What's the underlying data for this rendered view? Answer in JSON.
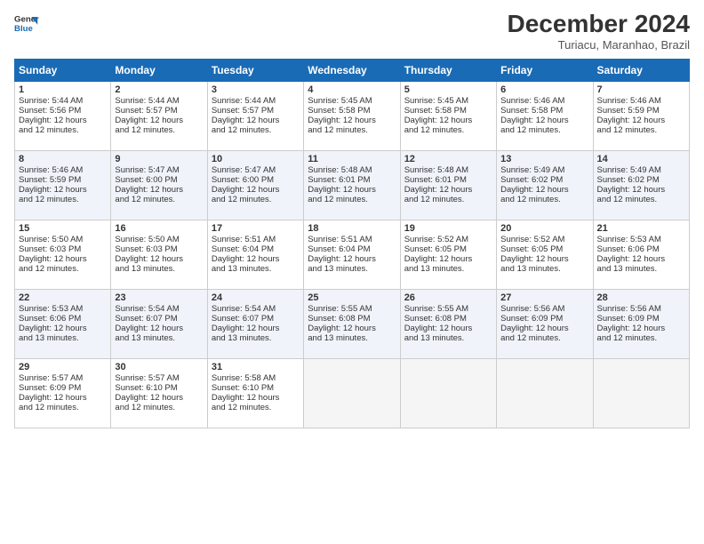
{
  "header": {
    "logo_line1": "General",
    "logo_line2": "Blue",
    "month_title": "December 2024",
    "subtitle": "Turiacu, Maranhao, Brazil"
  },
  "days_of_week": [
    "Sunday",
    "Monday",
    "Tuesday",
    "Wednesday",
    "Thursday",
    "Friday",
    "Saturday"
  ],
  "weeks": [
    [
      {
        "day": "1",
        "lines": [
          "Sunrise: 5:44 AM",
          "Sunset: 5:56 PM",
          "Daylight: 12 hours",
          "and 12 minutes."
        ]
      },
      {
        "day": "2",
        "lines": [
          "Sunrise: 5:44 AM",
          "Sunset: 5:57 PM",
          "Daylight: 12 hours",
          "and 12 minutes."
        ]
      },
      {
        "day": "3",
        "lines": [
          "Sunrise: 5:44 AM",
          "Sunset: 5:57 PM",
          "Daylight: 12 hours",
          "and 12 minutes."
        ]
      },
      {
        "day": "4",
        "lines": [
          "Sunrise: 5:45 AM",
          "Sunset: 5:58 PM",
          "Daylight: 12 hours",
          "and 12 minutes."
        ]
      },
      {
        "day": "5",
        "lines": [
          "Sunrise: 5:45 AM",
          "Sunset: 5:58 PM",
          "Daylight: 12 hours",
          "and 12 minutes."
        ]
      },
      {
        "day": "6",
        "lines": [
          "Sunrise: 5:46 AM",
          "Sunset: 5:58 PM",
          "Daylight: 12 hours",
          "and 12 minutes."
        ]
      },
      {
        "day": "7",
        "lines": [
          "Sunrise: 5:46 AM",
          "Sunset: 5:59 PM",
          "Daylight: 12 hours",
          "and 12 minutes."
        ]
      }
    ],
    [
      {
        "day": "8",
        "lines": [
          "Sunrise: 5:46 AM",
          "Sunset: 5:59 PM",
          "Daylight: 12 hours",
          "and 12 minutes."
        ]
      },
      {
        "day": "9",
        "lines": [
          "Sunrise: 5:47 AM",
          "Sunset: 6:00 PM",
          "Daylight: 12 hours",
          "and 12 minutes."
        ]
      },
      {
        "day": "10",
        "lines": [
          "Sunrise: 5:47 AM",
          "Sunset: 6:00 PM",
          "Daylight: 12 hours",
          "and 12 minutes."
        ]
      },
      {
        "day": "11",
        "lines": [
          "Sunrise: 5:48 AM",
          "Sunset: 6:01 PM",
          "Daylight: 12 hours",
          "and 12 minutes."
        ]
      },
      {
        "day": "12",
        "lines": [
          "Sunrise: 5:48 AM",
          "Sunset: 6:01 PM",
          "Daylight: 12 hours",
          "and 12 minutes."
        ]
      },
      {
        "day": "13",
        "lines": [
          "Sunrise: 5:49 AM",
          "Sunset: 6:02 PM",
          "Daylight: 12 hours",
          "and 12 minutes."
        ]
      },
      {
        "day": "14",
        "lines": [
          "Sunrise: 5:49 AM",
          "Sunset: 6:02 PM",
          "Daylight: 12 hours",
          "and 12 minutes."
        ]
      }
    ],
    [
      {
        "day": "15",
        "lines": [
          "Sunrise: 5:50 AM",
          "Sunset: 6:03 PM",
          "Daylight: 12 hours",
          "and 12 minutes."
        ]
      },
      {
        "day": "16",
        "lines": [
          "Sunrise: 5:50 AM",
          "Sunset: 6:03 PM",
          "Daylight: 12 hours",
          "and 13 minutes."
        ]
      },
      {
        "day": "17",
        "lines": [
          "Sunrise: 5:51 AM",
          "Sunset: 6:04 PM",
          "Daylight: 12 hours",
          "and 13 minutes."
        ]
      },
      {
        "day": "18",
        "lines": [
          "Sunrise: 5:51 AM",
          "Sunset: 6:04 PM",
          "Daylight: 12 hours",
          "and 13 minutes."
        ]
      },
      {
        "day": "19",
        "lines": [
          "Sunrise: 5:52 AM",
          "Sunset: 6:05 PM",
          "Daylight: 12 hours",
          "and 13 minutes."
        ]
      },
      {
        "day": "20",
        "lines": [
          "Sunrise: 5:52 AM",
          "Sunset: 6:05 PM",
          "Daylight: 12 hours",
          "and 13 minutes."
        ]
      },
      {
        "day": "21",
        "lines": [
          "Sunrise: 5:53 AM",
          "Sunset: 6:06 PM",
          "Daylight: 12 hours",
          "and 13 minutes."
        ]
      }
    ],
    [
      {
        "day": "22",
        "lines": [
          "Sunrise: 5:53 AM",
          "Sunset: 6:06 PM",
          "Daylight: 12 hours",
          "and 13 minutes."
        ]
      },
      {
        "day": "23",
        "lines": [
          "Sunrise: 5:54 AM",
          "Sunset: 6:07 PM",
          "Daylight: 12 hours",
          "and 13 minutes."
        ]
      },
      {
        "day": "24",
        "lines": [
          "Sunrise: 5:54 AM",
          "Sunset: 6:07 PM",
          "Daylight: 12 hours",
          "and 13 minutes."
        ]
      },
      {
        "day": "25",
        "lines": [
          "Sunrise: 5:55 AM",
          "Sunset: 6:08 PM",
          "Daylight: 12 hours",
          "and 13 minutes."
        ]
      },
      {
        "day": "26",
        "lines": [
          "Sunrise: 5:55 AM",
          "Sunset: 6:08 PM",
          "Daylight: 12 hours",
          "and 13 minutes."
        ]
      },
      {
        "day": "27",
        "lines": [
          "Sunrise: 5:56 AM",
          "Sunset: 6:09 PM",
          "Daylight: 12 hours",
          "and 12 minutes."
        ]
      },
      {
        "day": "28",
        "lines": [
          "Sunrise: 5:56 AM",
          "Sunset: 6:09 PM",
          "Daylight: 12 hours",
          "and 12 minutes."
        ]
      }
    ],
    [
      {
        "day": "29",
        "lines": [
          "Sunrise: 5:57 AM",
          "Sunset: 6:09 PM",
          "Daylight: 12 hours",
          "and 12 minutes."
        ]
      },
      {
        "day": "30",
        "lines": [
          "Sunrise: 5:57 AM",
          "Sunset: 6:10 PM",
          "Daylight: 12 hours",
          "and 12 minutes."
        ]
      },
      {
        "day": "31",
        "lines": [
          "Sunrise: 5:58 AM",
          "Sunset: 6:10 PM",
          "Daylight: 12 hours",
          "and 12 minutes."
        ]
      },
      null,
      null,
      null,
      null
    ]
  ]
}
